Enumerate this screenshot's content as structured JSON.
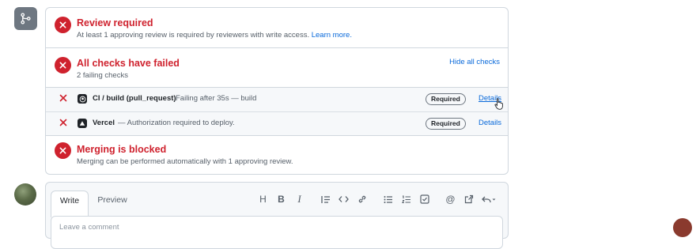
{
  "merge_box": {
    "review": {
      "title": "Review required",
      "subtitle": "At least 1 approving review is required by reviewers with write access.",
      "learn_more": "Learn more."
    },
    "checks": {
      "title": "All checks have failed",
      "subtitle": "2 failing checks",
      "hide_label": "Hide all checks",
      "items": [
        {
          "name": "CI / build (pull_request)",
          "description": "Failing after 35s — build",
          "badge": "Required",
          "details": "Details",
          "logo": "github-icon"
        },
        {
          "name": "Vercel",
          "description": "— Authorization required to deploy.",
          "badge": "Required",
          "details": "Details",
          "logo": "vercel-icon"
        }
      ]
    },
    "merging": {
      "title": "Merging is blocked",
      "subtitle": "Merging can be performed automatically with 1 approving review."
    }
  },
  "comment": {
    "tabs": [
      "Write",
      "Preview"
    ],
    "active_tab": "Write",
    "placeholder": "Leave a comment",
    "toolbar": [
      "heading-icon",
      "bold-icon",
      "italic-icon",
      "quote-icon",
      "code-icon",
      "link-icon",
      "unordered-list-icon",
      "ordered-list-icon",
      "task-list-icon",
      "mention-icon",
      "reference-icon",
      "undo-icon"
    ]
  },
  "colors": {
    "danger": "#cf222e",
    "link": "#0969da",
    "muted": "#57606a",
    "border": "#d0d7de"
  }
}
